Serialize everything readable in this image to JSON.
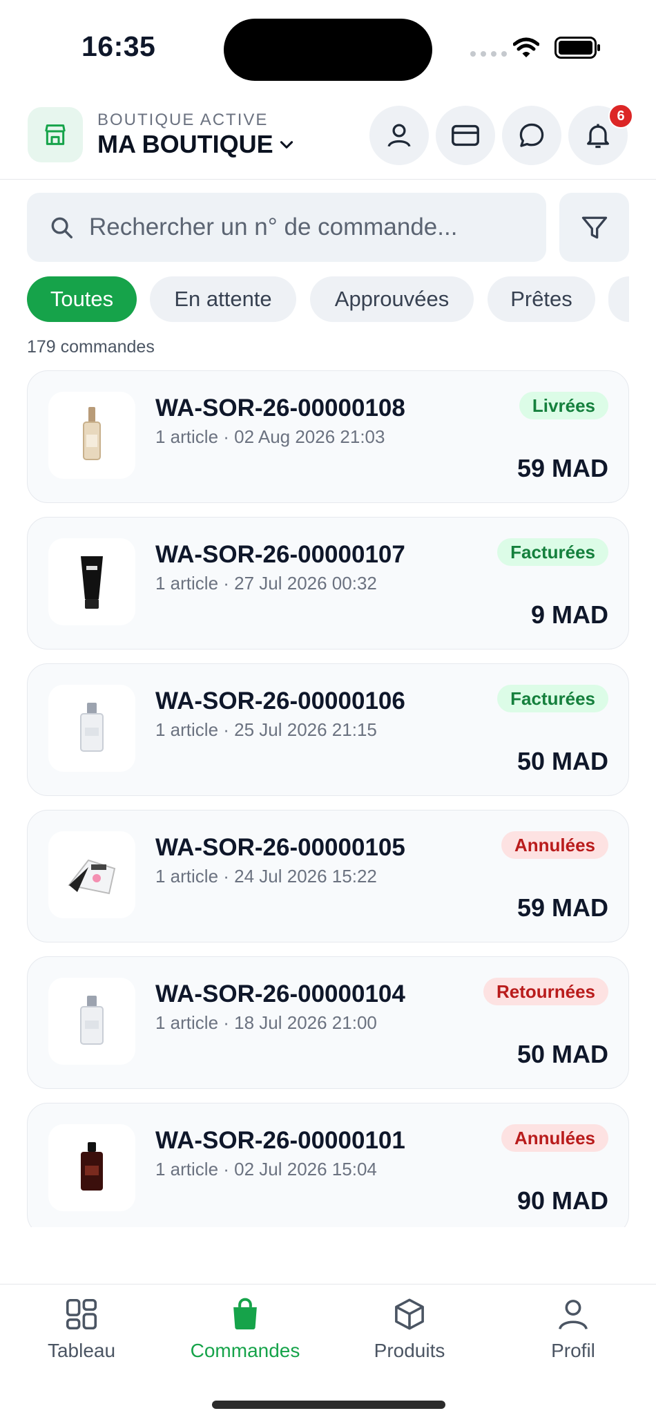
{
  "status_bar": {
    "time": "16:35"
  },
  "header": {
    "subtitle": "BOUTIQUE ACTIVE",
    "store_name": "MA BOUTIQUE",
    "notification_count": "6"
  },
  "search": {
    "placeholder": "Rechercher un n° de commande..."
  },
  "filters": [
    "Toutes",
    "En attente",
    "Approuvées",
    "Prêtes"
  ],
  "order_count": "179 commandes",
  "orders": [
    {
      "id": "WA-SOR-26-00000108",
      "meta": "1 article · 02 Aug 2026 21:03",
      "status": "Livrées",
      "status_color": "green",
      "amount": "59 MAD",
      "product": "perfume-spray-gold"
    },
    {
      "id": "WA-SOR-26-00000107",
      "meta": "1 article · 27 Jul 2026 00:32",
      "status": "Facturées",
      "status_color": "green",
      "amount": "9 MAD",
      "product": "black-tube"
    },
    {
      "id": "WA-SOR-26-00000106",
      "meta": "1 article · 25 Jul 2026 21:15",
      "status": "Facturées",
      "status_color": "green",
      "amount": "50 MAD",
      "product": "perfume-bottle-clear"
    },
    {
      "id": "WA-SOR-26-00000105",
      "meta": "1 article · 24 Jul 2026 15:22",
      "status": "Annulées",
      "status_color": "red",
      "amount": "59 MAD",
      "product": "blush-palette"
    },
    {
      "id": "WA-SOR-26-00000104",
      "meta": "1 article · 18 Jul 2026 21:00",
      "status": "Retournées",
      "status_color": "red",
      "amount": "50 MAD",
      "product": "perfume-bottle-clear"
    },
    {
      "id": "WA-SOR-26-00000101",
      "meta": "1 article · 02 Jul 2026 15:04",
      "status": "Annulées",
      "status_color": "red",
      "amount": "90 MAD",
      "product": "perfume-bottle-dark"
    }
  ],
  "nav": [
    {
      "label": "Tableau",
      "icon": "grid-icon"
    },
    {
      "label": "Commandes",
      "icon": "bag-icon",
      "active": true
    },
    {
      "label": "Produits",
      "icon": "box-icon"
    },
    {
      "label": "Profil",
      "icon": "user-icon"
    }
  ],
  "colors": {
    "accent": "#16a34a",
    "badge_red": "#dc2626"
  }
}
